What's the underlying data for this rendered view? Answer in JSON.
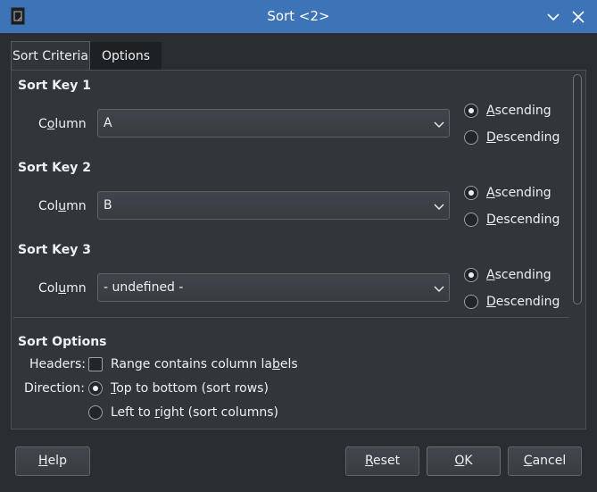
{
  "window": {
    "title": "Sort <2>"
  },
  "tabs": [
    {
      "label": "Sort Criteria",
      "active": true
    },
    {
      "label": "Options",
      "active": false
    }
  ],
  "sort_keys": [
    {
      "heading": "Sort Key 1",
      "column_label_pre": "C",
      "column_label_u": "o",
      "column_label_post": "lumn",
      "value": "A",
      "ascending_selected": true
    },
    {
      "heading": "Sort Key 2",
      "column_label_pre": "Col",
      "column_label_u": "u",
      "column_label_post": "mn",
      "value": "B",
      "ascending_selected": true
    },
    {
      "heading": "Sort Key 3",
      "column_label_pre": "Col",
      "column_label_u": "u",
      "column_label_post": "mn",
      "value": "- undefined -",
      "ascending_selected": true
    }
  ],
  "order": {
    "ascending_u": "A",
    "ascending_rest": "scending",
    "descending_u": "D",
    "descending_rest": "escending"
  },
  "sort_options": {
    "heading": "Sort Options",
    "headers_label": "Headers:",
    "headers_checkbox_pre": "Range contains column la",
    "headers_checkbox_u": "b",
    "headers_checkbox_post": "els",
    "headers_checked": false,
    "direction_label": "Direction:",
    "dir_rows_u": "T",
    "dir_rows_rest": "op to bottom (sort rows)",
    "dir_cols_pre": "Left to ",
    "dir_cols_u": "r",
    "dir_cols_post": "ight (sort columns)",
    "rows_selected": true
  },
  "buttons": {
    "help_u": "H",
    "help_rest": "elp",
    "reset_u": "R",
    "reset_rest": "eset",
    "ok_u": "O",
    "ok_rest": "K",
    "cancel_u": "C",
    "cancel_rest": "ancel"
  },
  "colors": {
    "titlebar": "#3d74b7",
    "background": "#2a2e32",
    "panel": "#31363b",
    "text": "#eff0f1"
  },
  "icons": [
    "document-icon",
    "chevron-down-icon",
    "close-icon",
    "dropdown-arrow-icon"
  ]
}
